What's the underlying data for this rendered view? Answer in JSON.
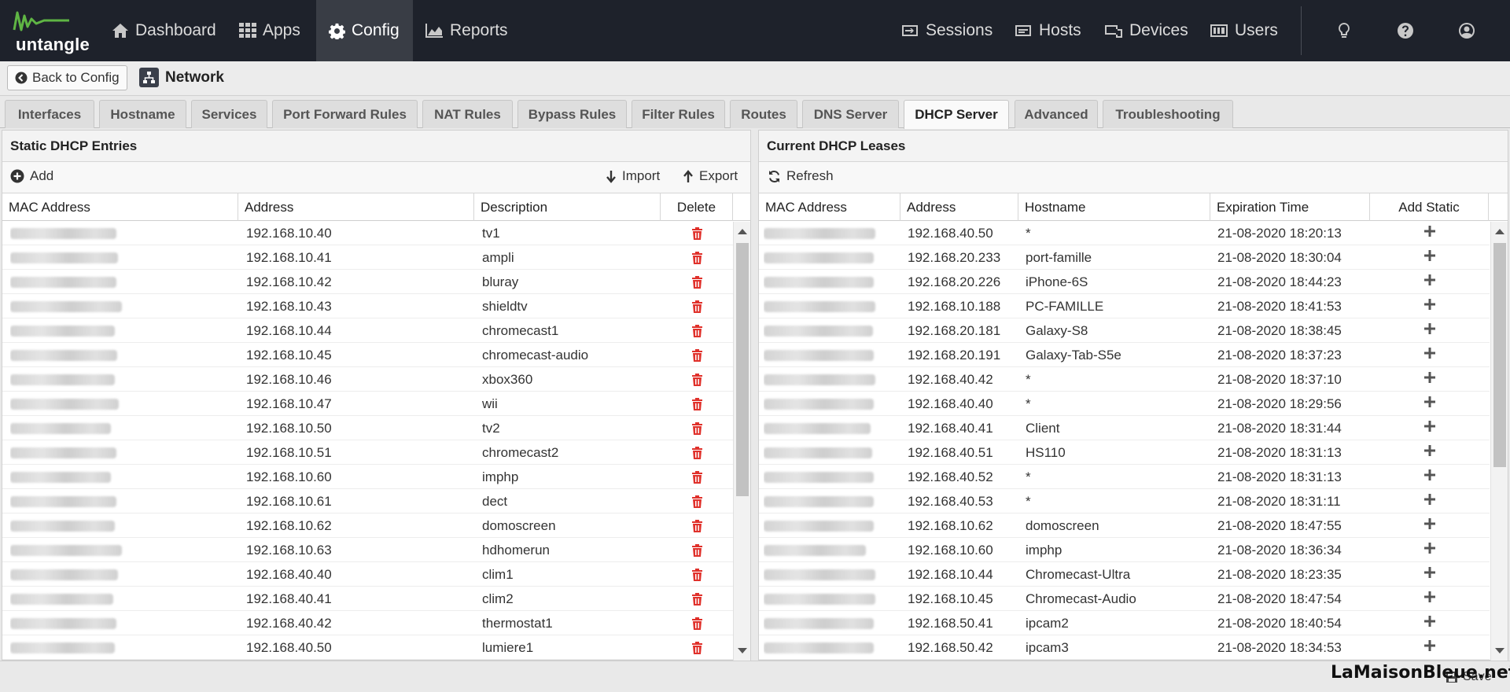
{
  "app": {
    "logo_text": "untangle"
  },
  "nav": {
    "left": [
      {
        "label": "Dashboard",
        "icon": "home-icon"
      },
      {
        "label": "Apps",
        "icon": "grid-icon"
      },
      {
        "label": "Config",
        "icon": "gear-icon",
        "active": true
      },
      {
        "label": "Reports",
        "icon": "chart-area-icon"
      }
    ],
    "right": [
      {
        "label": "Sessions",
        "icon": "sessions-icon"
      },
      {
        "label": "Hosts",
        "icon": "hosts-icon"
      },
      {
        "label": "Devices",
        "icon": "devices-icon"
      },
      {
        "label": "Users",
        "icon": "users-icon"
      }
    ]
  },
  "titlebar": {
    "back_label": "Back to Config",
    "section": "Network"
  },
  "tabs": [
    "Interfaces",
    "Hostname",
    "Services",
    "Port Forward Rules",
    "NAT Rules",
    "Bypass Rules",
    "Filter Rules",
    "Routes",
    "DNS Server",
    "DHCP Server",
    "Advanced",
    "Troubleshooting"
  ],
  "active_tab": "DHCP Server",
  "static": {
    "title": "Static DHCP Entries",
    "add_label": "Add",
    "import_label": "Import",
    "export_label": "Export",
    "columns": [
      "MAC Address",
      "Address",
      "Description",
      "Delete"
    ],
    "rows": [
      {
        "address": "192.168.10.40",
        "description": "tv1"
      },
      {
        "address": "192.168.10.41",
        "description": "ampli"
      },
      {
        "address": "192.168.10.42",
        "description": "bluray"
      },
      {
        "address": "192.168.10.43",
        "description": "shieldtv"
      },
      {
        "address": "192.168.10.44",
        "description": "chromecast1"
      },
      {
        "address": "192.168.10.45",
        "description": "chromecast-audio"
      },
      {
        "address": "192.168.10.46",
        "description": "xbox360"
      },
      {
        "address": "192.168.10.47",
        "description": "wii"
      },
      {
        "address": "192.168.10.50",
        "description": "tv2"
      },
      {
        "address": "192.168.10.51",
        "description": "chromecast2"
      },
      {
        "address": "192.168.10.60",
        "description": "imphp"
      },
      {
        "address": "192.168.10.61",
        "description": "dect"
      },
      {
        "address": "192.168.10.62",
        "description": "domoscreen"
      },
      {
        "address": "192.168.10.63",
        "description": "hdhomerun"
      },
      {
        "address": "192.168.40.40",
        "description": "clim1"
      },
      {
        "address": "192.168.40.41",
        "description": "clim2"
      },
      {
        "address": "192.168.40.42",
        "description": "thermostat1"
      },
      {
        "address": "192.168.40.50",
        "description": "lumiere1"
      }
    ]
  },
  "leases": {
    "title": "Current DHCP Leases",
    "refresh_label": "Refresh",
    "columns": [
      "MAC Address",
      "Address",
      "Hostname",
      "Expiration Time",
      "Add Static"
    ],
    "rows": [
      {
        "address": "192.168.40.50",
        "hostname": "*",
        "expiration": "21-08-2020 18:20:13"
      },
      {
        "address": "192.168.20.233",
        "hostname": "port-famille",
        "expiration": "21-08-2020 18:30:04"
      },
      {
        "address": "192.168.20.226",
        "hostname": "iPhone-6S",
        "expiration": "21-08-2020 18:44:23"
      },
      {
        "address": "192.168.10.188",
        "hostname": "PC-FAMILLE",
        "expiration": "21-08-2020 18:41:53"
      },
      {
        "address": "192.168.20.181",
        "hostname": "Galaxy-S8",
        "expiration": "21-08-2020 18:38:45"
      },
      {
        "address": "192.168.20.191",
        "hostname": "Galaxy-Tab-S5e",
        "expiration": "21-08-2020 18:37:23"
      },
      {
        "address": "192.168.40.42",
        "hostname": "*",
        "expiration": "21-08-2020 18:37:10"
      },
      {
        "address": "192.168.40.40",
        "hostname": "*",
        "expiration": "21-08-2020 18:29:56"
      },
      {
        "address": "192.168.40.41",
        "hostname": "Client",
        "expiration": "21-08-2020 18:31:44"
      },
      {
        "address": "192.168.40.51",
        "hostname": "HS110",
        "expiration": "21-08-2020 18:31:13"
      },
      {
        "address": "192.168.40.52",
        "hostname": "*",
        "expiration": "21-08-2020 18:31:13"
      },
      {
        "address": "192.168.40.53",
        "hostname": "*",
        "expiration": "21-08-2020 18:31:11"
      },
      {
        "address": "192.168.10.62",
        "hostname": "domoscreen",
        "expiration": "21-08-2020 18:47:55"
      },
      {
        "address": "192.168.10.60",
        "hostname": "imphp",
        "expiration": "21-08-2020 18:36:34"
      },
      {
        "address": "192.168.10.44",
        "hostname": "Chromecast-Ultra",
        "expiration": "21-08-2020 18:23:35"
      },
      {
        "address": "192.168.10.45",
        "hostname": "Chromecast-Audio",
        "expiration": "21-08-2020 18:47:54"
      },
      {
        "address": "192.168.50.41",
        "hostname": "ipcam2",
        "expiration": "21-08-2020 18:40:54"
      },
      {
        "address": "192.168.50.42",
        "hostname": "ipcam3",
        "expiration": "21-08-2020 18:34:53"
      }
    ]
  },
  "footer": {
    "watermark": "LaMaisonBleue.net",
    "save_label": "Save"
  },
  "colors": {
    "topbar": "#1e222b",
    "active_nav": "#393d45",
    "logo_green": "#5fb544",
    "delete_red": "#e0312b"
  }
}
